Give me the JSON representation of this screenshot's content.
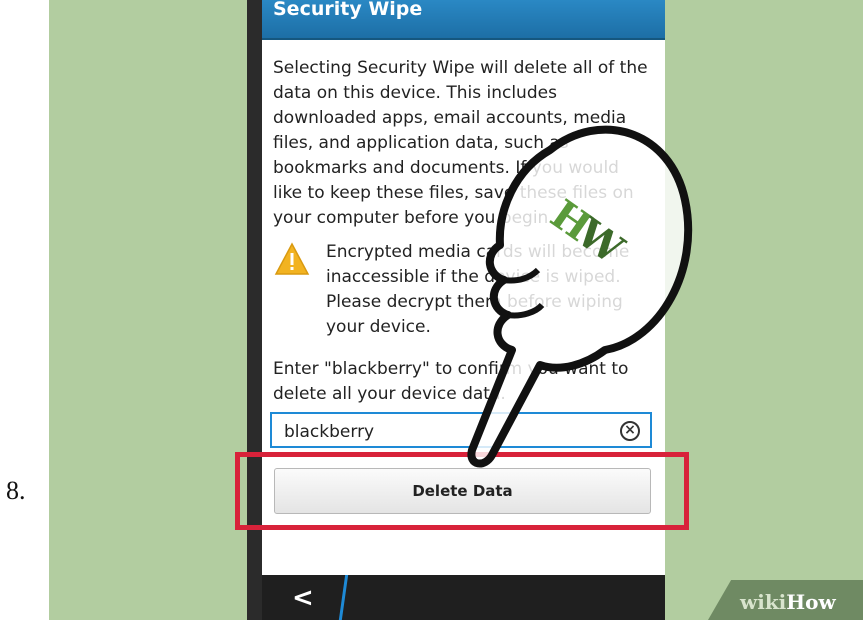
{
  "step_number": "8.",
  "header": {
    "title": "Security Wipe"
  },
  "body": {
    "description": "Selecting Security Wipe will delete all of the data on this device. This includes downloaded apps, email accounts, media files, and application data, such as bookmarks and documents. If you would like to keep these files, save these files on your computer before you begin."
  },
  "warning": {
    "icon": "warning-triangle-icon",
    "text": "Encrypted media cards will become inaccessible if the device is wiped. Please decrypt them before wiping your device."
  },
  "confirm": {
    "prompt": "Enter \"blackberry\" to confirm you want to delete all your device data.",
    "input_value": "blackberry",
    "clear_icon": "clear-circle-icon"
  },
  "delete_button": {
    "label": "Delete Data"
  },
  "action_bar": {
    "back_icon": "back-chevron-icon",
    "back_glyph": "<"
  },
  "watermark": {
    "wiki": "wiki",
    "how": "How"
  },
  "colors": {
    "header": "#1d6fa6",
    "highlight": "#d8223a",
    "input_border": "#1e8ad6",
    "background": "#b2cda0"
  }
}
